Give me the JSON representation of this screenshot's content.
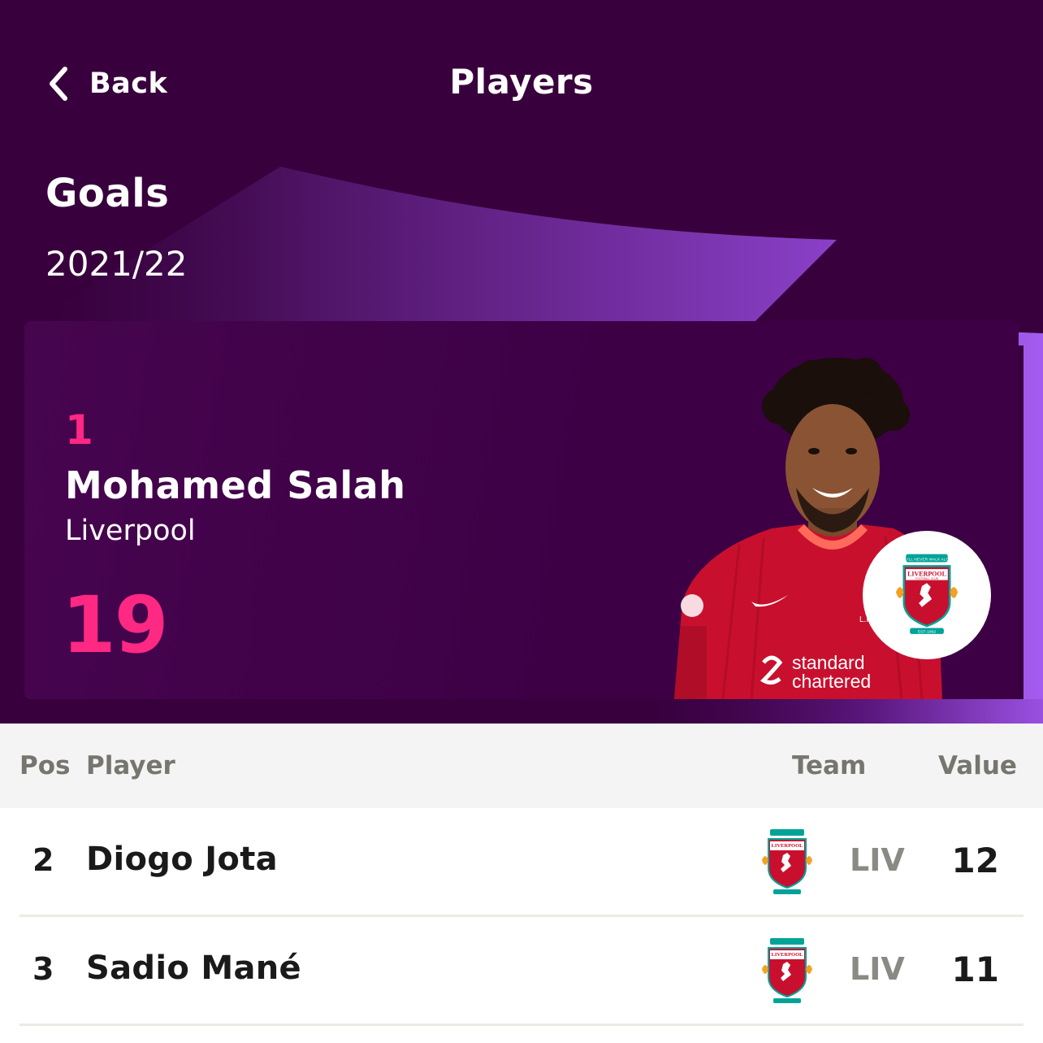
{
  "header": {
    "back_label": "Back",
    "title": "Players"
  },
  "stat": {
    "title": "Goals",
    "season": "2021/22"
  },
  "leader": {
    "rank": "1",
    "name": "Mohamed Salah",
    "club": "Liverpool",
    "value": "19",
    "shirt_sponsor": "standard chartered",
    "shirt_club_initials": "L.F.C."
  },
  "table": {
    "headers": {
      "pos": "Pos",
      "player": "Player",
      "team": "Team",
      "value": "Value"
    },
    "rows": [
      {
        "pos": "2",
        "name": "Diogo Jota",
        "team": "LIV",
        "value": "12"
      },
      {
        "pos": "3",
        "name": "Sadio Mané",
        "team": "LIV",
        "value": "11"
      }
    ]
  },
  "crest_text": {
    "motto": "YOU'LL NEVER WALK ALONE",
    "club": "LIVERPOOL",
    "sub": "FOOTBALL CLUB",
    "est": "EST·1892"
  },
  "colors": {
    "primary_purple": "#38003c",
    "accent_pink": "#ff2882",
    "gradient_violet": "#963cff",
    "liverpool_red": "#c8102e",
    "liverpool_green": "#00a398"
  },
  "icons": {
    "back": "chevron-left-icon",
    "club_crest": "liverpool-crest-icon"
  }
}
